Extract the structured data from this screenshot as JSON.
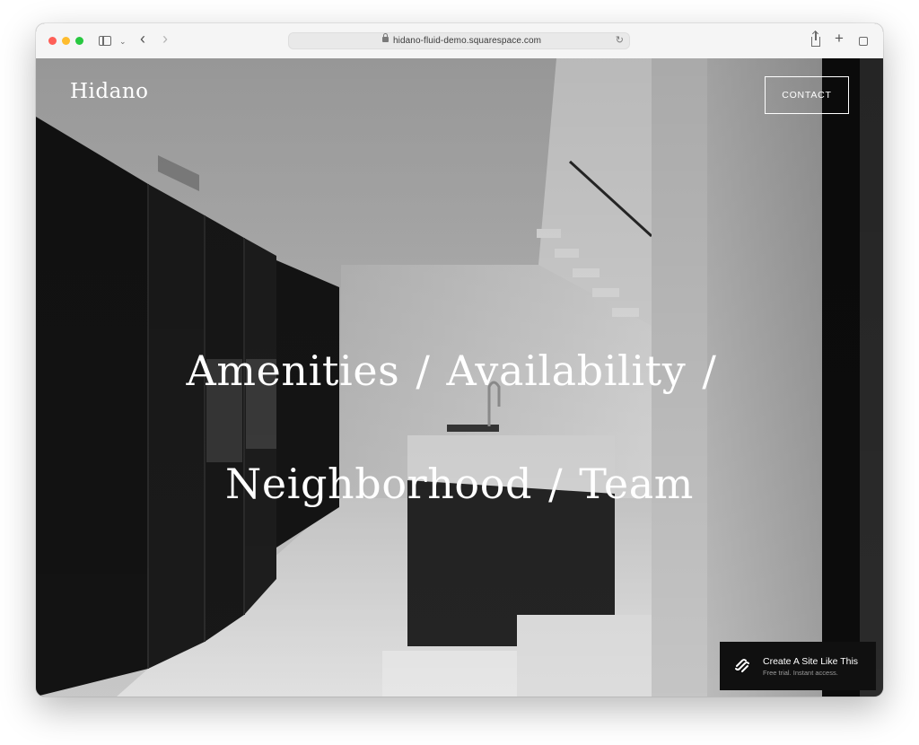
{
  "browser": {
    "url": "hidano-fluid-demo.squarespace.com",
    "icons": [
      "sidebar-icon",
      "chevron-down-icon",
      "back-icon",
      "forward-icon",
      "lock-icon",
      "reload-icon",
      "share-icon",
      "plus-icon",
      "tabs-icon"
    ]
  },
  "site": {
    "brand": "Hidano",
    "contact_label": "CONTACT",
    "nav": {
      "line1": [
        {
          "label": "Amenities"
        },
        {
          "label": "Availability"
        }
      ],
      "line2": [
        {
          "label": "Neighborhood"
        },
        {
          "label": "Team"
        }
      ],
      "separator": "/"
    }
  },
  "promo": {
    "title": "Create A Site Like This",
    "subtitle": "Free trial. Instant access.",
    "icon": "squarespace-logo-icon"
  },
  "colors": {
    "hero_text": "#ffffff",
    "promo_bg": "#101010",
    "cabinet_dark": "#1c1c1c",
    "wall_light": "#d9d9d9"
  }
}
